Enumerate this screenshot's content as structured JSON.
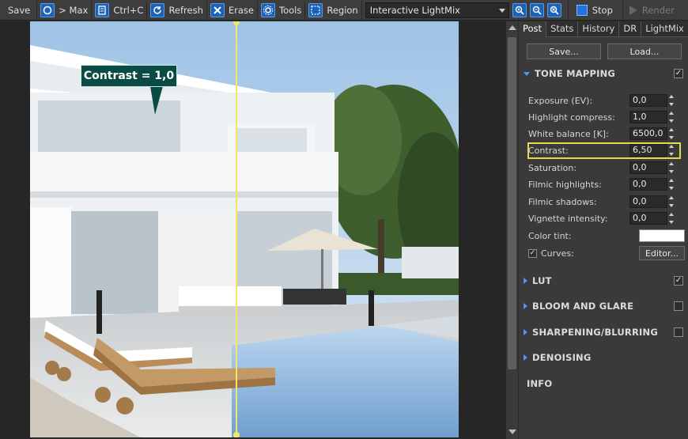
{
  "toolbar": {
    "save": "Save",
    "max": "> Max",
    "copy": "Ctrl+C",
    "refresh": "Refresh",
    "erase": "Erase",
    "tools": "Tools",
    "region": "Region",
    "channel": "Interactive LightMix",
    "stop": "Stop",
    "render": "Render"
  },
  "viewport": {
    "callout": "Contrast = 1,0"
  },
  "panel": {
    "tabs": [
      "Post",
      "Stats",
      "History",
      "DR",
      "LightMix"
    ],
    "save_btn": "Save...",
    "load_btn": "Load...",
    "tone_mapping": {
      "title": "TONE MAPPING",
      "checked": "✓",
      "params": [
        {
          "label": "Exposure (EV):",
          "value": "0,0"
        },
        {
          "label": "Highlight compress:",
          "value": "1,0"
        },
        {
          "label": "White balance [K]:",
          "value": "6500,0"
        },
        {
          "label": "Contrast:",
          "value": "6,50"
        },
        {
          "label": "Saturation:",
          "value": "0,0"
        },
        {
          "label": "Filmic highlights:",
          "value": "0,0"
        },
        {
          "label": "Filmic shadows:",
          "value": "0,0"
        },
        {
          "label": "Vignette intensity:",
          "value": "0,0"
        }
      ],
      "color_tint_label": "Color tint:",
      "color_tint": "#ffffff",
      "curves_label": "Curves:",
      "editor_btn": "Editor..."
    },
    "sections": [
      {
        "title": "LUT",
        "checked": "✓"
      },
      {
        "title": "BLOOM AND GLARE",
        "checked": ""
      },
      {
        "title": "SHARPENING/BLURRING",
        "checked": ""
      },
      {
        "title": "DENOISING"
      }
    ],
    "info": "INFO"
  }
}
